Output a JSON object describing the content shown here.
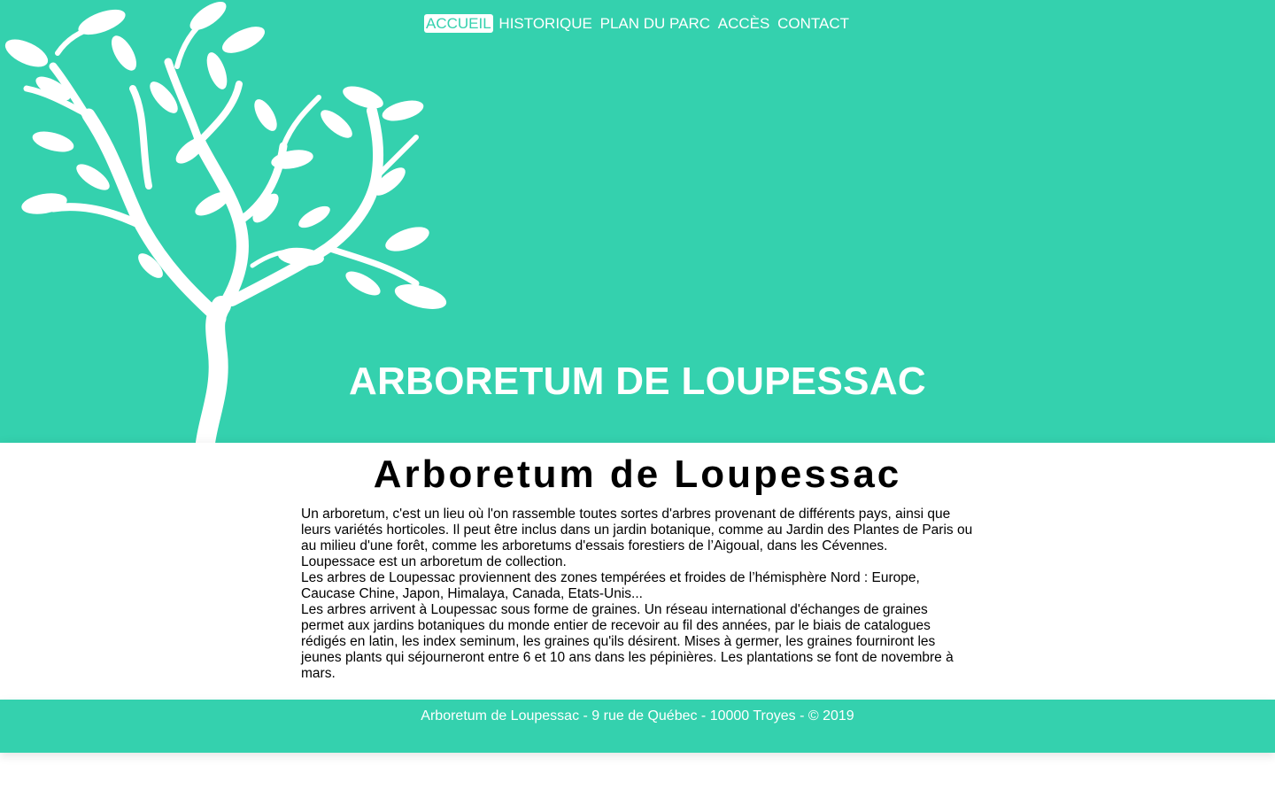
{
  "colors": {
    "accent": "#34d1ae",
    "text": "#000000",
    "inverse": "#ffffff"
  },
  "header": {
    "logo_icon": "tree-icon",
    "nav": [
      {
        "label": "ACCUEIL",
        "active": true
      },
      {
        "label": "HISTORIQUE",
        "active": false
      },
      {
        "label": "PLAN DU PARC",
        "active": false
      },
      {
        "label": "ACCÈS",
        "active": false
      },
      {
        "label": "CONTACT",
        "active": false
      }
    ],
    "site_title": "ARBORETUM DE LOUPESSAC"
  },
  "main": {
    "title": "Arboretum de Loupessac",
    "paragraphs": [
      "Un arboretum, c'est un lieu où l'on rassemble toutes sortes d'arbres provenant de différents pays, ainsi que leurs variétés horticoles. Il peut être inclus dans un jardin botanique, comme au Jardin des Plantes de Paris ou au milieu d'une forêt, comme les arboretums d'essais forestiers de l’Aigoual, dans les Cévennes.",
      "Loupessace est un arboretum de collection.",
      "Les arbres de Loupessac proviennent des zones tempérées et froides de l’hémisphère Nord : Europe, Caucase Chine, Japon, Himalaya, Canada, Etats-Unis...",
      "Les arbres arrivent à Loupessac sous forme de graines. Un réseau international d'échanges de graines permet aux jardins botaniques du monde entier de recevoir au fil des années, par le biais de catalogues rédigés en latin, les index seminum, les graines qu'ils désirent. Mises à germer, les graines fourniront les jeunes plants qui séjourneront entre 6 et 10 ans dans les pépinières. Les plantations se font de novembre à mars."
    ]
  },
  "footer": {
    "text": "Arboretum de Loupessac - 9 rue de Québec - 10000 Troyes - © 2019"
  }
}
